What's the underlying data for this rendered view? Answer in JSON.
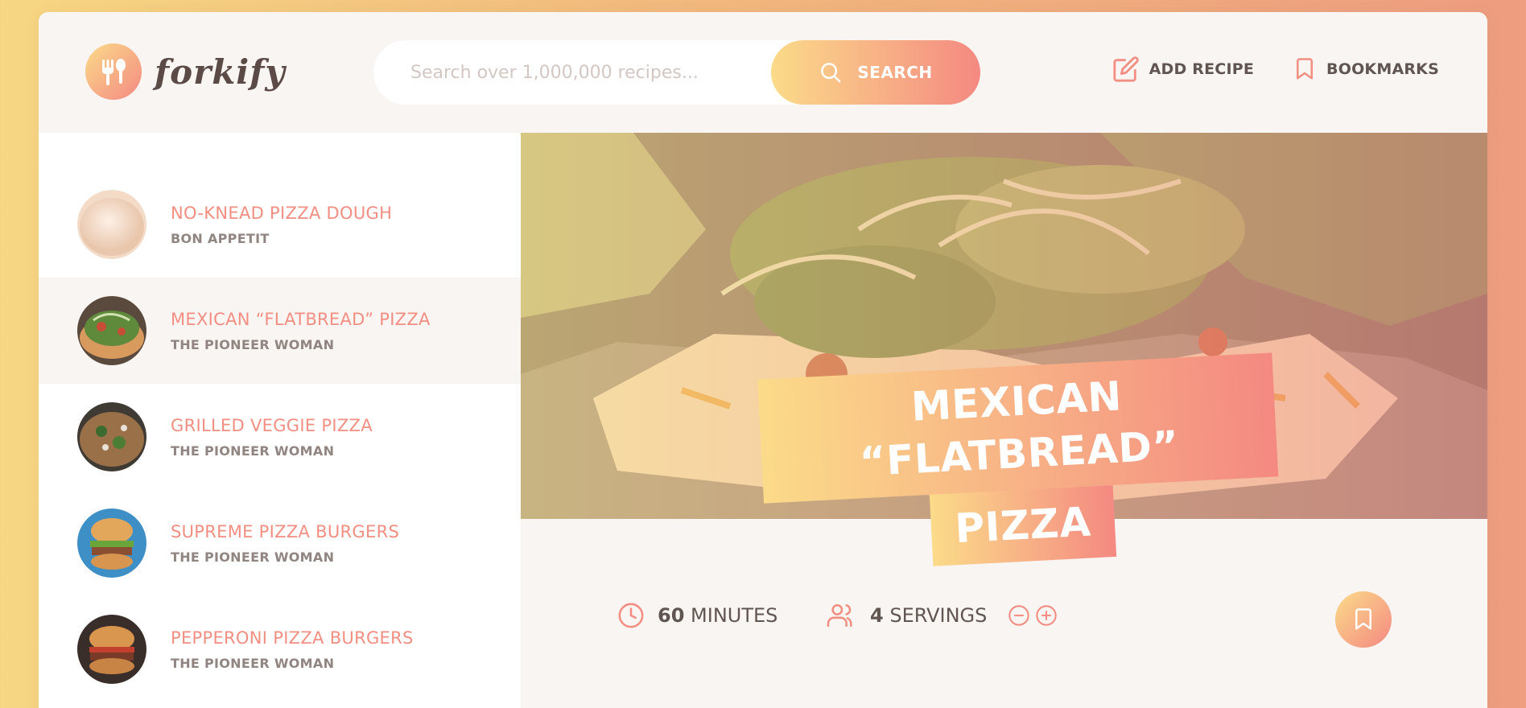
{
  "header": {
    "logo_text": "forkify",
    "search": {
      "placeholder": "Search over 1,000,000 recipes...",
      "value": "",
      "button_label": "SEARCH"
    },
    "nav": {
      "add_recipe_label": "ADD RECIPE",
      "bookmarks_label": "BOOKMARKS"
    }
  },
  "results": [
    {
      "title": "NO-KNEAD PIZZA DOUGH",
      "publisher": "BON APPETIT",
      "active": false
    },
    {
      "title": "MEXICAN “FLATBREAD” PIZZA",
      "publisher": "THE PIONEER WOMAN",
      "active": true
    },
    {
      "title": "GRILLED VEGGIE PIZZA",
      "publisher": "THE PIONEER WOMAN",
      "active": false
    },
    {
      "title": "SUPREME PIZZA BURGERS",
      "publisher": "THE PIONEER WOMAN",
      "active": false
    },
    {
      "title": "PEPPERONI PIZZA BURGERS",
      "publisher": "THE PIONEER WOMAN",
      "active": false
    }
  ],
  "recipe": {
    "title_line1": "MEXICAN “FLATBREAD”",
    "title_line2": "PIZZA",
    "cooking_time": "60",
    "cooking_unit": "MINUTES",
    "servings": "4",
    "servings_unit": "SERVINGS"
  },
  "colors": {
    "accent": "#f38e82",
    "gradient_start": "#fbdb89",
    "gradient_end": "#f48982",
    "text": "#615551",
    "muted": "#918581",
    "panel": "#f9f5f3"
  },
  "icons": [
    "fork-spoon-logo-icon",
    "search-icon",
    "edit-icon",
    "bookmark-icon",
    "clock-icon",
    "users-icon",
    "minus-circle-icon",
    "plus-circle-icon"
  ]
}
